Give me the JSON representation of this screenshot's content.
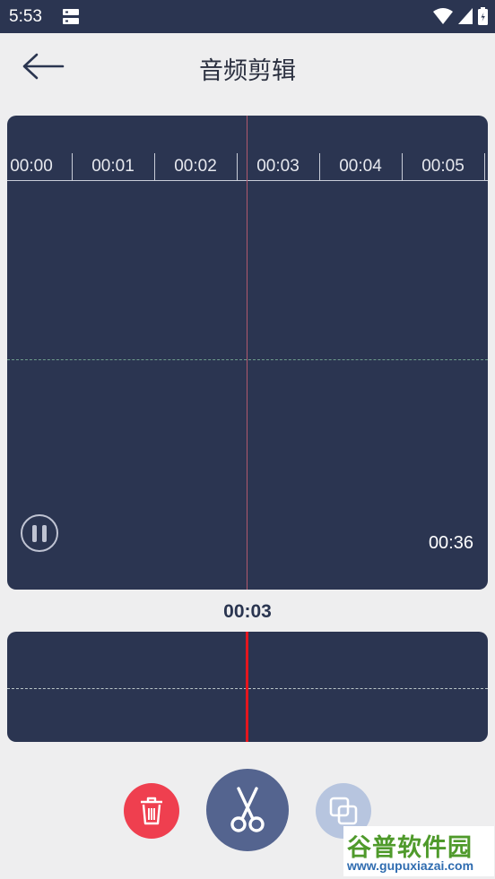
{
  "status_bar": {
    "time": "5:53"
  },
  "header": {
    "title": "音频剪辑"
  },
  "timeline": {
    "ticks": [
      "00:00",
      "00:01",
      "00:02",
      "00:03",
      "00:04",
      "00:05"
    ]
  },
  "player": {
    "total_duration": "00:36",
    "current_time": "00:03",
    "state": "playing"
  },
  "actions": {
    "delete": "trash-icon",
    "cut": "scissors-icon",
    "copy": "copy-icon"
  },
  "colors": {
    "panel_bg": "#2b3551",
    "playhead": "#e4161e",
    "delete_button": "#ef3f4f",
    "cut_button": "#54648f",
    "copy_button": "#b7c5df"
  },
  "watermark": {
    "brand": "谷普软件园",
    "url": "www.gupuxiazai.com"
  }
}
